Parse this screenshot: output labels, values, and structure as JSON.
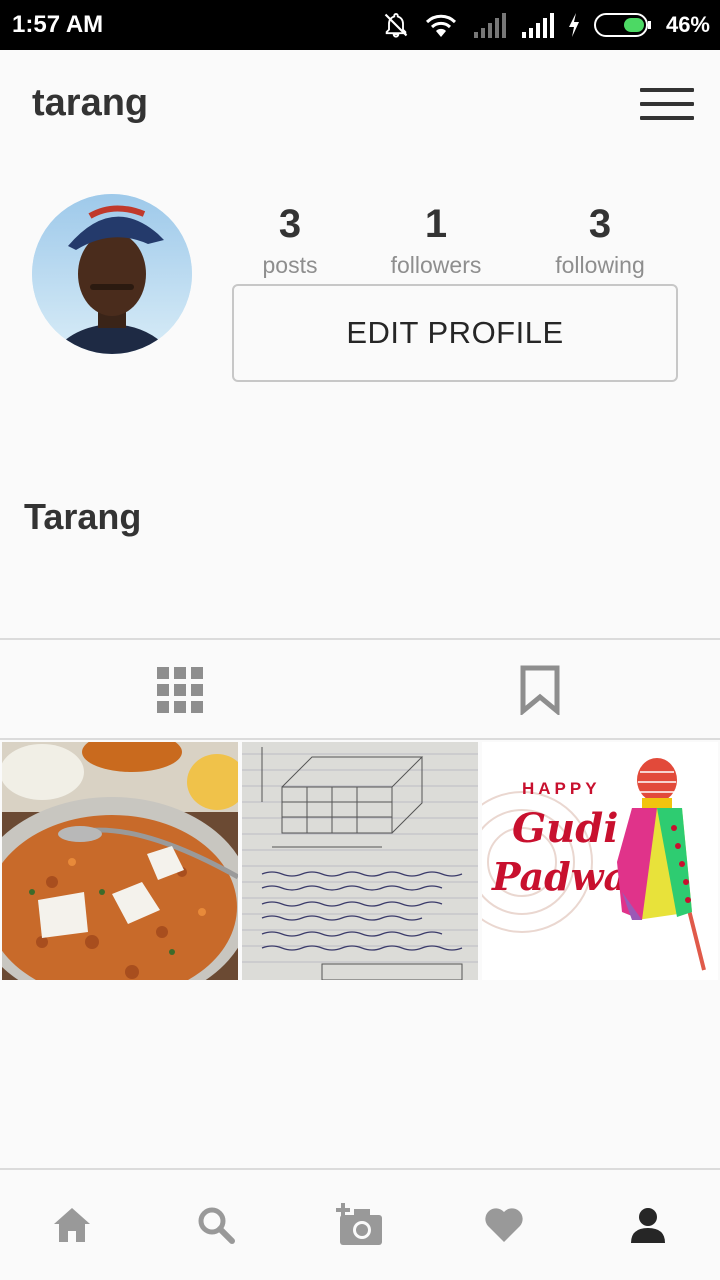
{
  "status_bar": {
    "time": "1:57 AM",
    "battery_percent": "46%"
  },
  "header": {
    "username": "tarang"
  },
  "profile": {
    "full_name": "Tarang",
    "stats": [
      {
        "value": "3",
        "label": "posts"
      },
      {
        "value": "1",
        "label": "followers"
      },
      {
        "value": "3",
        "label": "following"
      }
    ],
    "edit_button_label": "EDIT PROFILE"
  },
  "tabs": [
    {
      "icon": "grid-icon"
    },
    {
      "icon": "bookmark-icon"
    }
  ],
  "posts": [
    {
      "image": "food-plate-photo"
    },
    {
      "image": "handwritten-notes-photo"
    },
    {
      "image": "gudi-padwa-greeting",
      "text_line1": "HAPPY",
      "text_line2": "Gudi",
      "text_line3": "Padwa"
    }
  ],
  "bottom_nav": [
    {
      "icon": "home-icon"
    },
    {
      "icon": "search-icon"
    },
    {
      "icon": "camera-add-icon"
    },
    {
      "icon": "heart-icon"
    },
    {
      "icon": "profile-icon"
    }
  ],
  "colors": {
    "text": "#262626",
    "muted": "#8e8e8e",
    "border": "#dbdbdb",
    "icon": "#999999",
    "accent_red": "#c8102e"
  }
}
